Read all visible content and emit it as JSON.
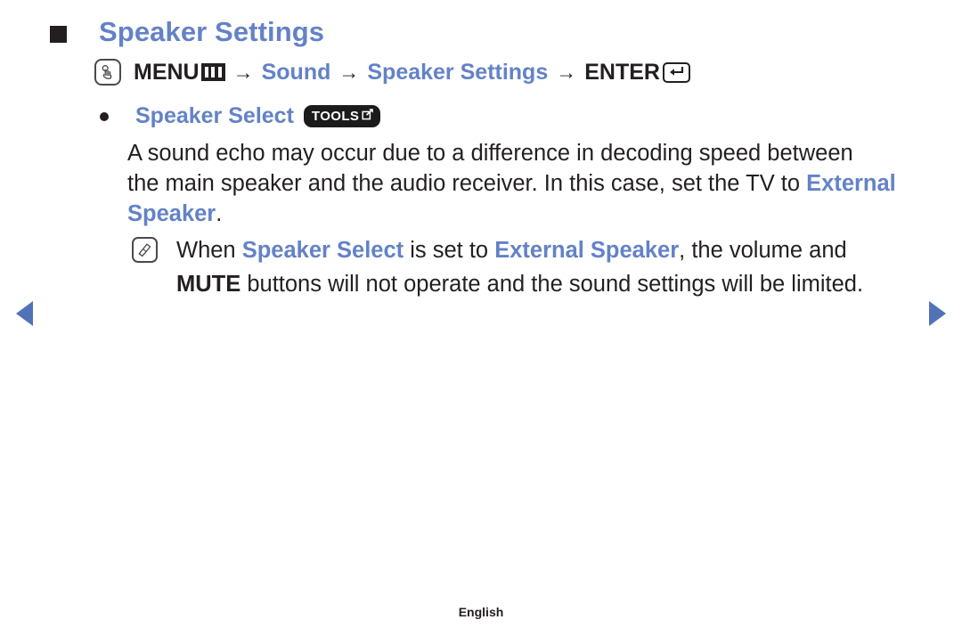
{
  "page": {
    "title": "Speaker Settings",
    "footer_language": "English",
    "accent_blue": "#6382c7",
    "arrow_blue": "#5272b8",
    "text_dark": "#231f20"
  },
  "menu_path": {
    "press_icon": "press-hand-icon",
    "menu_label": "MENU",
    "menu_icon": "menu-grid-icon",
    "arrow_1": "→",
    "step_sound": "Sound",
    "arrow_2": "→",
    "step_speaker_settings": "Speaker Settings",
    "arrow_3": "→",
    "enter_label": "ENTER",
    "enter_icon": "enter-return-icon"
  },
  "sub_item": {
    "bullet": "•",
    "label": "Speaker Select",
    "badge_text": "TOOLS",
    "badge_icon": "tools-arrow-icon"
  },
  "body": {
    "line1": "A sound echo may occur due to a difference in decoding speed between",
    "line2_a": "the main speaker and the audio receiver. In this case, set the TV to ",
    "line2_b": "External",
    "line3_a": "Speaker",
    "line3_b": "."
  },
  "note": {
    "icon": "note-pen-icon",
    "line1_a": "When ",
    "line1_b": "Speaker Select",
    "line1_c": " is set to ",
    "line1_d": "External Speaker",
    "line1_e": ", the volume and",
    "line2_a": "MUTE",
    "line2_b": " buttons will not operate and the sound settings will be limited."
  },
  "nav": {
    "prev": "previous-page-arrow",
    "next": "next-page-arrow"
  }
}
